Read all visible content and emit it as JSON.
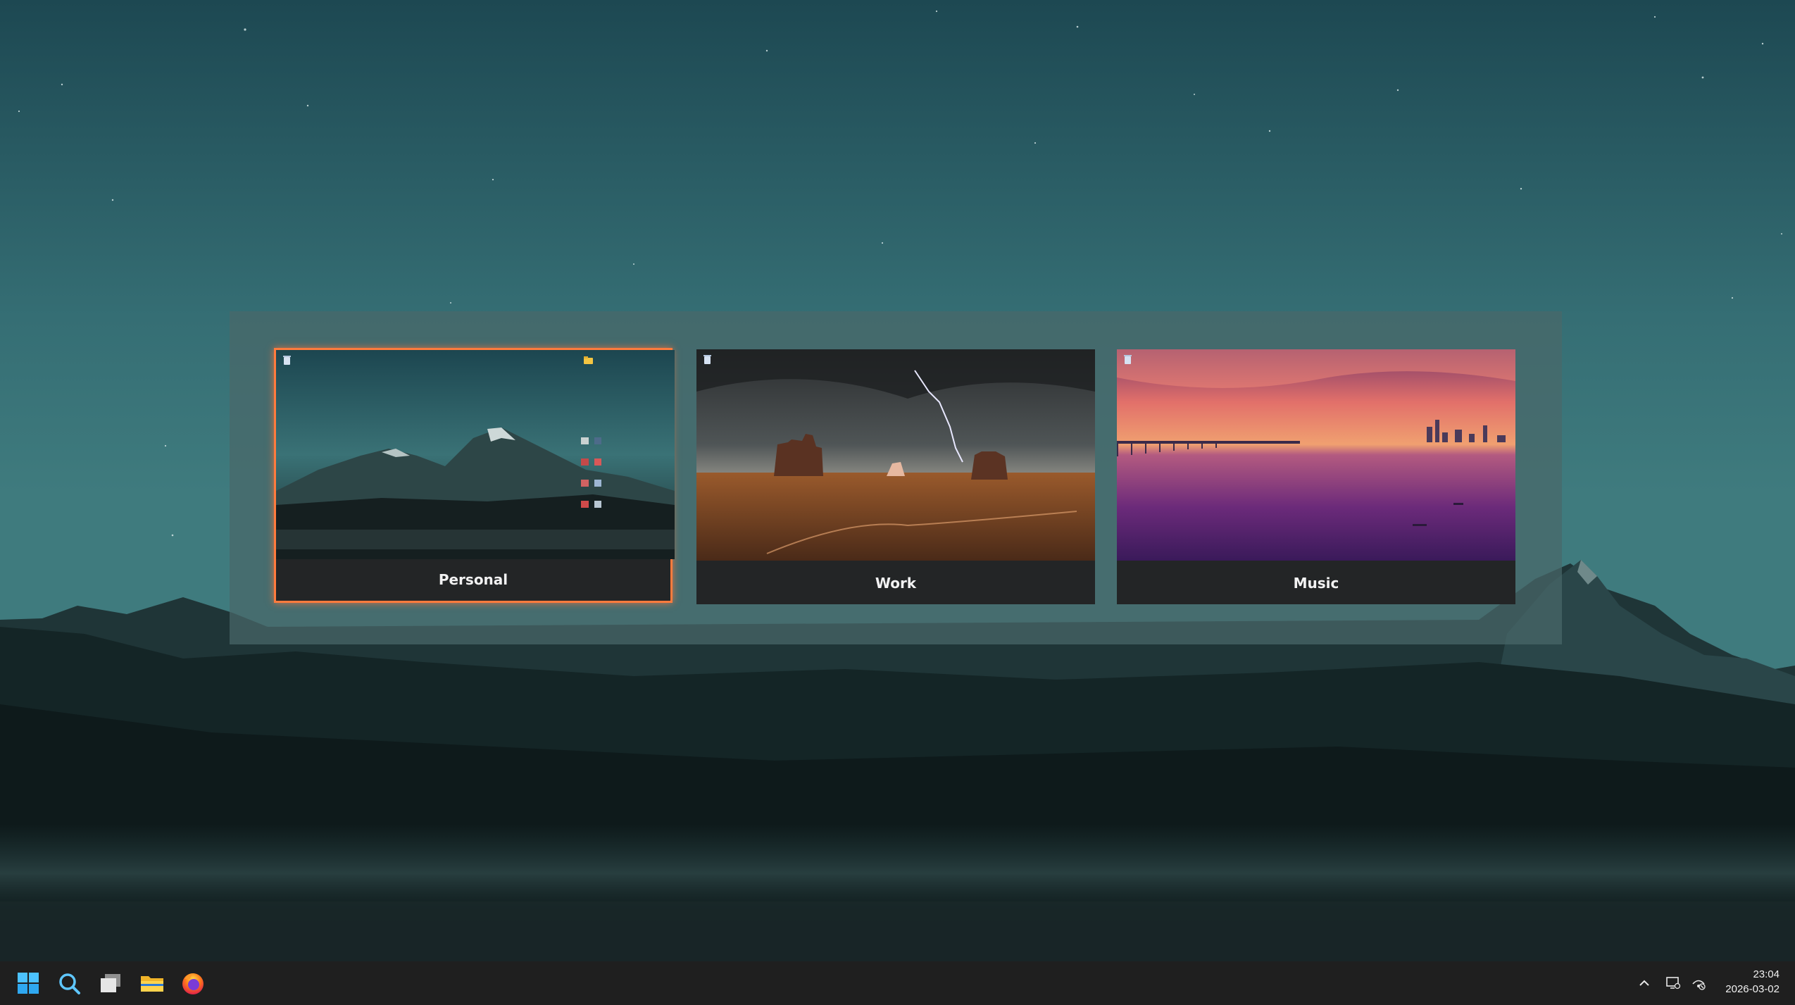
{
  "workspaces": [
    {
      "label": "Personal",
      "selected": true,
      "wallpaper": "mountain-night"
    },
    {
      "label": "Work",
      "selected": false,
      "wallpaper": "desert-storm"
    },
    {
      "label": "Music",
      "selected": false,
      "wallpaper": "pink-sunset-bay"
    }
  ],
  "taskbar": {
    "pinned": [
      {
        "name": "start-button",
        "icon": "windows-logo-icon"
      },
      {
        "name": "search-button",
        "icon": "search-icon"
      },
      {
        "name": "task-view-button",
        "icon": "task-view-icon"
      },
      {
        "name": "file-explorer-button",
        "icon": "folder-icon"
      },
      {
        "name": "firefox-button",
        "icon": "firefox-icon"
      }
    ],
    "tray": {
      "icons": [
        "chevron-up-icon",
        "display-icon",
        "network-icon"
      ]
    },
    "clock": {
      "time": "23:04",
      "date": "2026-03-02"
    }
  },
  "colors": {
    "selected_border": "#ff7b3d",
    "taskbar_bg": "#1f1f1f",
    "panel_bg": "#4a686a"
  }
}
